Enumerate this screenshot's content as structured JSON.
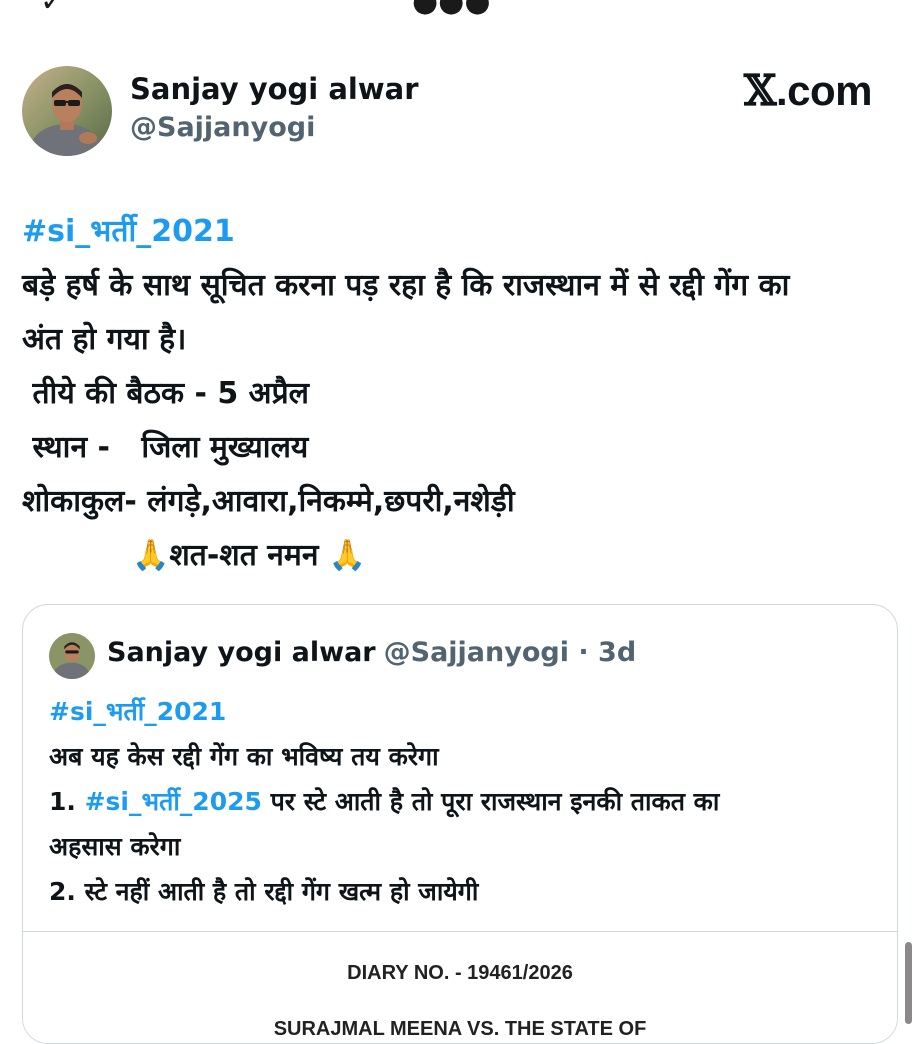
{
  "author": {
    "name": "Sanjay yogi alwar",
    "handle": "@Sajjanyogi"
  },
  "brand": {
    "x_mark": "𝕏",
    "domain": ".com"
  },
  "tweet": {
    "hashtag": "#si_भर्ती_2021",
    "lines": [
      "बड़े हर्ष के साथ सूचित करना पड़ रहा है कि राजस्थान में से रद्दी गेंग का",
      "अंत हो गया है।",
      " तीये की बैठक - 5 अप्रैल",
      " स्थान -   जिला मुख्यालय",
      "शोकाकुल- लंगड़े,आवारा,निकम्मे,छपरी,नशेड़ी",
      "🙏शत-शत नमन 🙏"
    ]
  },
  "quoted": {
    "name": "Sanjay yogi alwar",
    "handle_meta": "@Sajjanyogi · 3d",
    "hashtag": "#si_भर्ती_2021",
    "line1": "अब यह केस रद्दी गेंग का भविष्य तय करेगा",
    "line2_prefix": "1. ",
    "line2_hashtag": "#si_भर्ती_2025",
    "line2_rest": " पर स्टे आती है तो पूरा राजस्थान इनकी ताकत का",
    "line3": "अहसास करेगा",
    "line4": "2. स्टे नहीं आती है तो रद्दी गेंग खत्म हो जायेगी",
    "document": {
      "diary": "DIARY NO. - 19461/2026",
      "case_title": "SURAJMAL MEENA VS. THE STATE OF"
    }
  },
  "colors": {
    "link": "#1d9bf0",
    "text": "#0f1419",
    "muted": "#536471",
    "border": "#cfd9de"
  }
}
